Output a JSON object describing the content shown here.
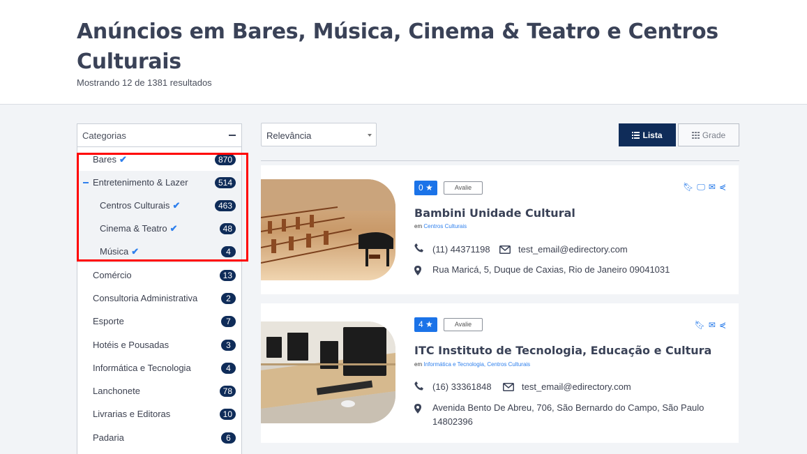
{
  "header": {
    "title": "Anúncios em Bares, Música, Cinema & Teatro e Centros Culturais",
    "results": "Mostrando 12 de 1381 resultados"
  },
  "sidebar": {
    "heading": "Categorias",
    "items": [
      {
        "label": "Bares",
        "count": "870",
        "checked": true
      },
      {
        "label": "Entretenimento & Lazer",
        "count": "514"
      },
      {
        "label": "Centros Culturais",
        "count": "463",
        "checked": true
      },
      {
        "label": "Cinema & Teatro",
        "count": "48",
        "checked": true
      },
      {
        "label": "Música",
        "count": "4",
        "checked": true
      },
      {
        "label": "Comércio",
        "count": "13"
      },
      {
        "label": "Consultoria Administrativa",
        "count": "2"
      },
      {
        "label": "Esporte",
        "count": "7"
      },
      {
        "label": "Hotéis e Pousadas",
        "count": "3"
      },
      {
        "label": "Informática e Tecnologia",
        "count": "4"
      },
      {
        "label": "Lanchonete",
        "count": "78"
      },
      {
        "label": "Livrarias e Editoras",
        "count": "10"
      },
      {
        "label": "Padaria",
        "count": "6"
      }
    ]
  },
  "controls": {
    "sort": "Relevância",
    "list_label": "Lista",
    "grid_label": "Grade"
  },
  "listings": [
    {
      "rating": "0",
      "review_label": "Avalie",
      "name": "Bambini Unidade Cultural",
      "em_prefix": "em",
      "categories": "Centros Culturais",
      "phone": "(11) 44371198",
      "email": "test_email@edirectory.com",
      "address": "Rua Maricá, 5, Duque de Caxias, Rio de Janeiro 09041031"
    },
    {
      "rating": "4",
      "review_label": "Avalie",
      "name": "ITC Instituto de Tecnologia, Educação e Cultura",
      "em_prefix": "em",
      "categories": "Informática e Tecnologia, Centros Culturais",
      "phone": "(16) 33361848",
      "email": "test_email@edirectory.com",
      "address_line1": "Avenida Bento De Abreu, 706, São Bernardo do Campo, São Paulo",
      "address_line2": "14802396"
    }
  ],
  "colors": {
    "navy": "#0f2c59",
    "accent": "#1b73e8",
    "highlight": "#ff0000"
  }
}
